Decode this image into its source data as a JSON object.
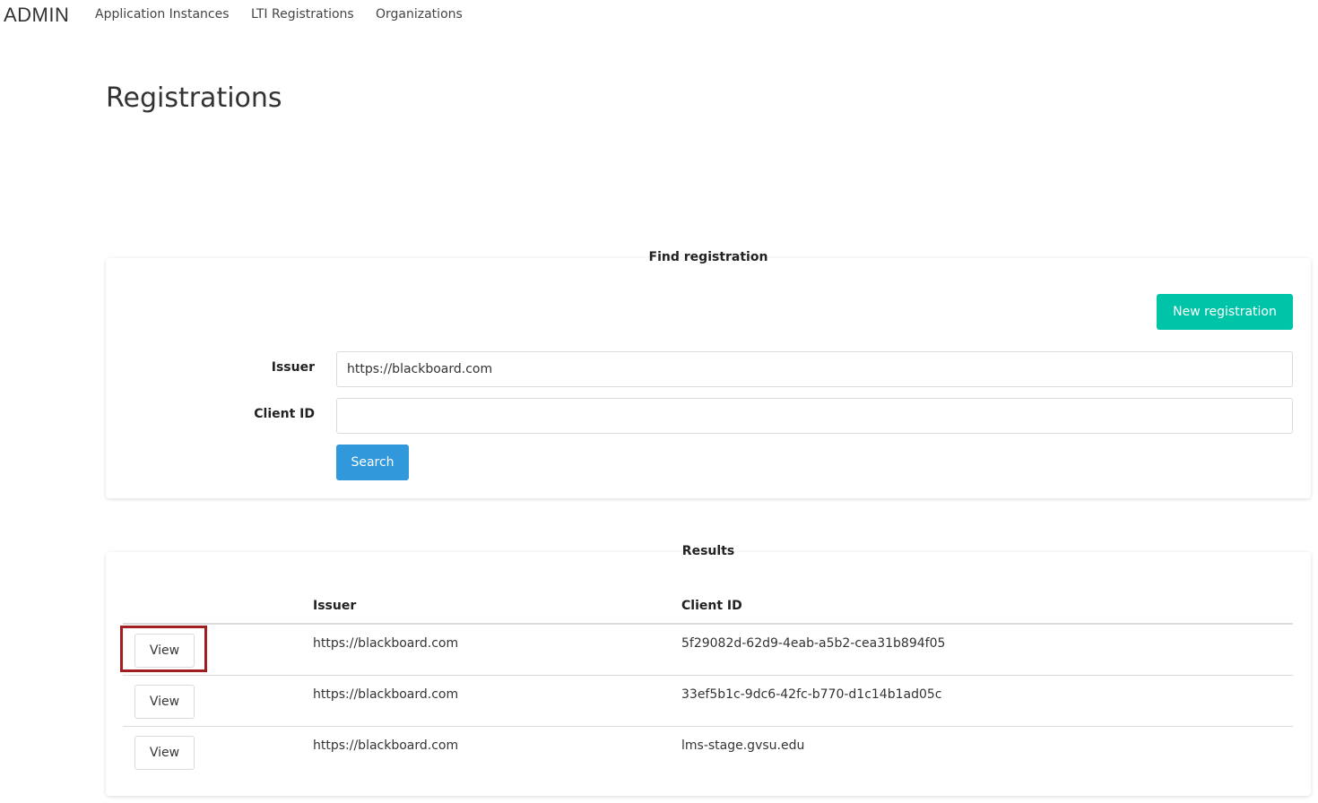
{
  "nav": {
    "brand": "ADMIN",
    "links": [
      "Application Instances",
      "LTI Registrations",
      "Organizations"
    ]
  },
  "page": {
    "title": "Registrations"
  },
  "find": {
    "title": "Find registration",
    "new_button": "New registration",
    "issuer_label": "Issuer",
    "issuer_value": "https://blackboard.com",
    "client_label": "Client ID",
    "client_value": "",
    "search_button": "Search"
  },
  "results": {
    "title": "Results",
    "columns": [
      "Issuer",
      "Client ID"
    ],
    "view_label": "View",
    "rows": [
      {
        "issuer": "https://blackboard.com",
        "client_id": "5f29082d-62d9-4eab-a5b2-cea31b894f05",
        "highlighted": true
      },
      {
        "issuer": "https://blackboard.com",
        "client_id": "33ef5b1c-9dc6-42fc-b770-d1c14b1ad05c",
        "highlighted": false
      },
      {
        "issuer": "https://blackboard.com",
        "client_id": "lms-stage.gvsu.edu",
        "highlighted": false
      }
    ]
  },
  "colors": {
    "new_button": "#00c4a7",
    "search_button": "#3298dc",
    "highlight": "#a31c22"
  }
}
